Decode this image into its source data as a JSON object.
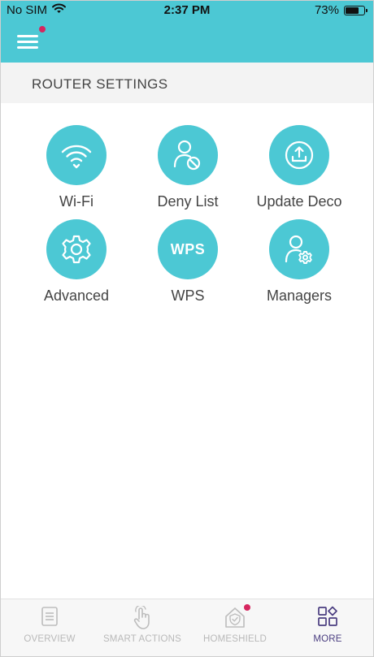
{
  "status_bar": {
    "carrier": "No SIM",
    "time": "2:37 PM",
    "battery": "73%",
    "battery_level": 0.73
  },
  "section": {
    "title": "ROUTER SETTINGS"
  },
  "tiles": [
    {
      "label": "Wi-Fi",
      "icon": "wifi-icon"
    },
    {
      "label": "Deny List",
      "icon": "deny-list-icon"
    },
    {
      "label": "Update Deco",
      "icon": "update-icon"
    },
    {
      "label": "Advanced",
      "icon": "gear-icon"
    },
    {
      "label": "WPS",
      "icon": "wps-icon",
      "icon_text": "WPS"
    },
    {
      "label": "Managers",
      "icon": "managers-icon"
    }
  ],
  "bottom_nav": [
    {
      "label": "OVERVIEW",
      "icon": "overview-icon",
      "active": false
    },
    {
      "label": "SMART ACTIONS",
      "icon": "smart-actions-icon",
      "active": false
    },
    {
      "label": "HOMESHIELD",
      "icon": "homeshield-icon",
      "active": false,
      "badge": true
    },
    {
      "label": "MORE",
      "icon": "more-icon",
      "active": true
    }
  ],
  "colors": {
    "accent": "#4cc8d4",
    "badge": "#d6265f",
    "active_nav": "#4a3d80"
  }
}
